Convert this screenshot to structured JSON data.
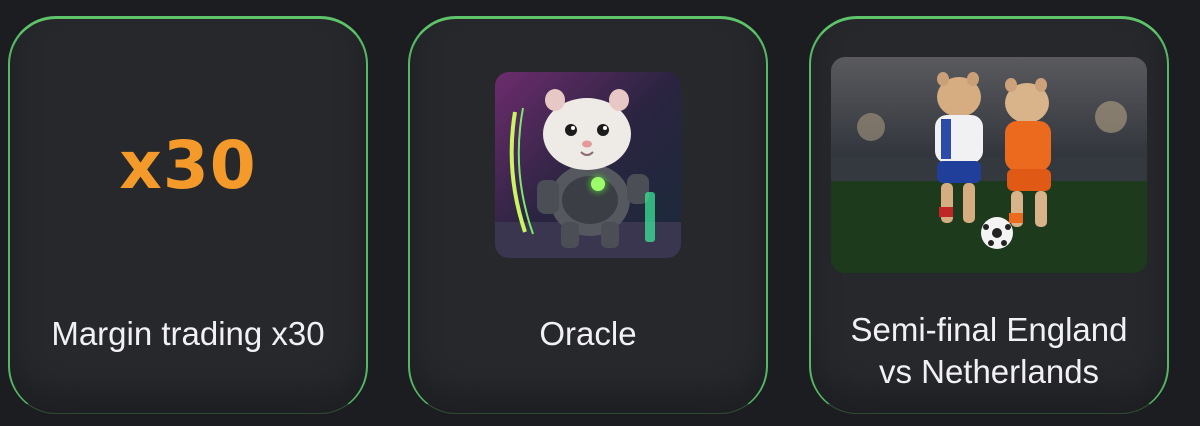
{
  "cards": [
    {
      "visual_text": "x30",
      "title": "Margin trading x30",
      "accent_color": "#f39a2a"
    },
    {
      "image": "hamster-robot-oracle",
      "title": "Oracle"
    },
    {
      "image": "hamsters-playing-football",
      "title_line1": "Semi-final England",
      "title_line2": "vs Netherlands"
    }
  ],
  "colors": {
    "background": "#1c1d20",
    "card": "#27282c",
    "card_border": "#5ec46a",
    "text": "#f1f1f3"
  }
}
